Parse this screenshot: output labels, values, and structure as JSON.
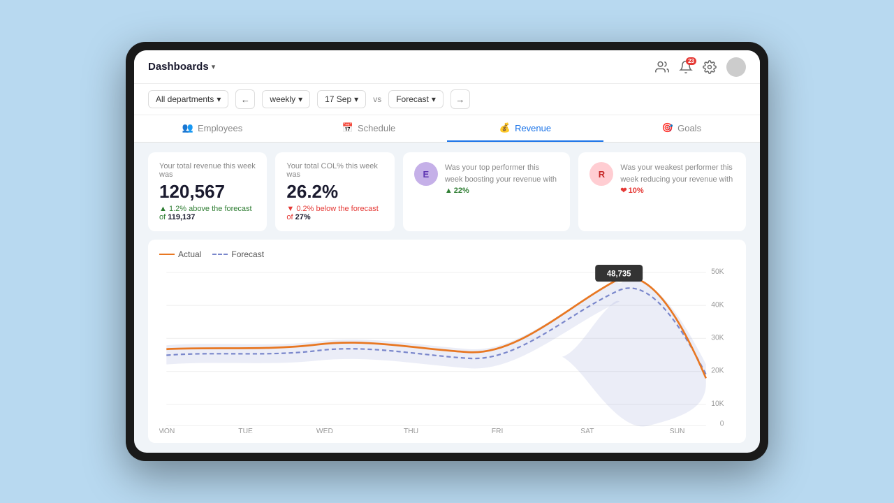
{
  "header": {
    "title": "Dashboards",
    "icons": {
      "people": "👥",
      "bell": "🔔",
      "settings": "⚙️"
    },
    "notification_count": "23"
  },
  "toolbar": {
    "department": "All departments",
    "period": "weekly",
    "date": "17 Sep",
    "vs_label": "vs",
    "forecast_label": "Forecast"
  },
  "tabs": [
    {
      "id": "employees",
      "label": "Employees",
      "icon": "👥",
      "active": false
    },
    {
      "id": "schedule",
      "label": "Schedule",
      "icon": "📅",
      "active": false
    },
    {
      "id": "revenue",
      "label": "Revenue",
      "icon": "💰",
      "active": true
    },
    {
      "id": "goals",
      "label": "Goals",
      "icon": "🎯",
      "active": false
    }
  ],
  "kpi": {
    "revenue": {
      "label": "Your total revenue this week was",
      "value": "120,567",
      "delta_label": "1.2% above the forecast of",
      "delta_direction": "up",
      "forecast_value": "119,137"
    },
    "col": {
      "label": "Your total COL% this week was",
      "value": "26.2%",
      "delta_label": "0.2% below the forecast of",
      "delta_direction": "down",
      "forecast_value": "27%"
    },
    "top_performer": {
      "initial": "E",
      "label": "Was your top performer this week boosting your revenue with",
      "stat": "22%",
      "direction": "up"
    },
    "weak_performer": {
      "initial": "R",
      "label": "Was your weakest performer this week reducing your revenue with",
      "stat": "10%",
      "direction": "down"
    }
  },
  "chart": {
    "legend_actual": "Actual",
    "legend_forecast": "Forecast",
    "tooltip_value": "48,735",
    "y_labels": [
      "50K",
      "40K",
      "30K",
      "20K",
      "10K",
      "0"
    ],
    "x_labels": [
      "MON",
      "TUE",
      "WED",
      "THU",
      "FRI",
      "SAT",
      "SUN"
    ]
  }
}
